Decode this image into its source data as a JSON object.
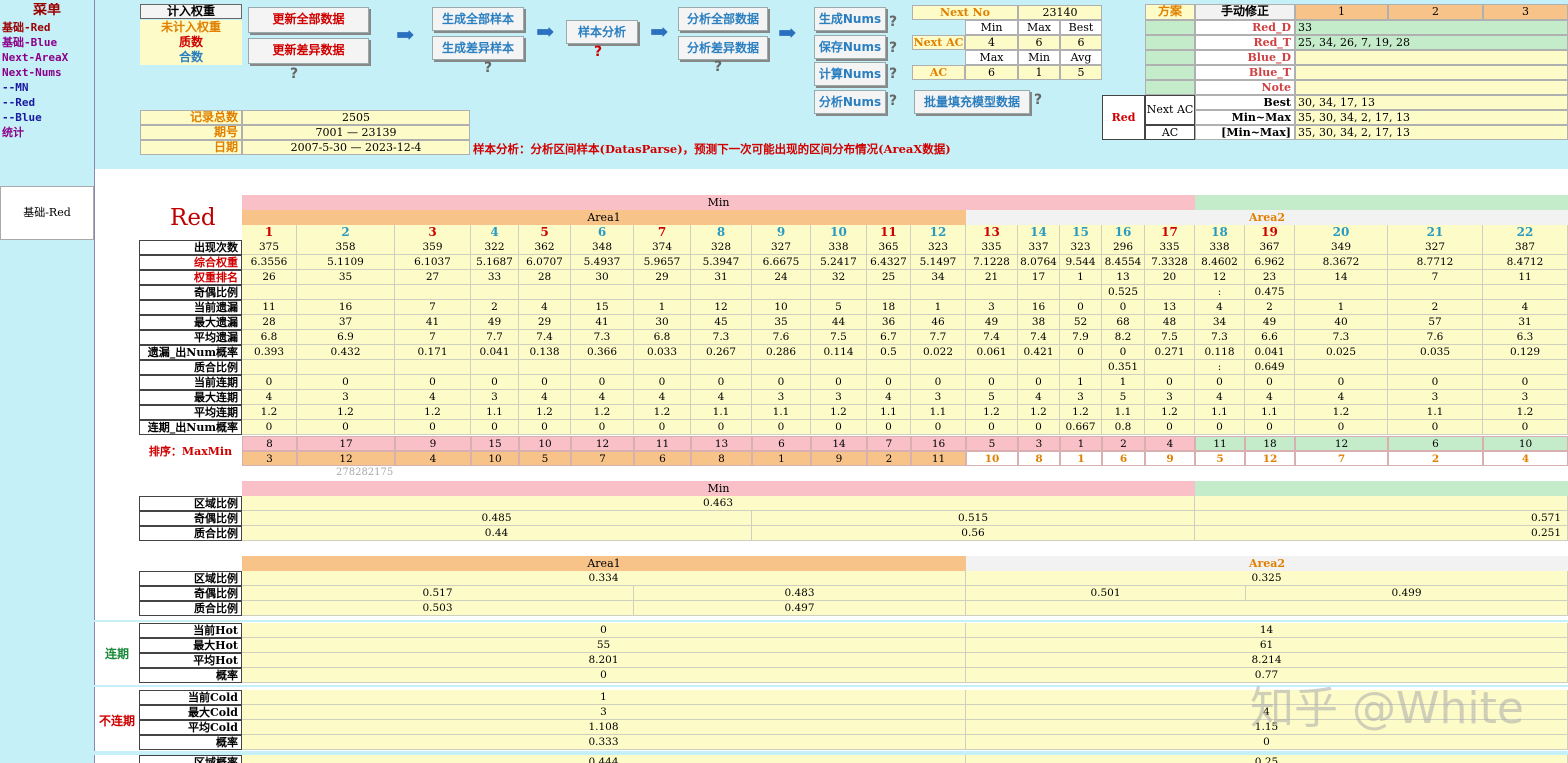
{
  "menu": {
    "title": "菜单",
    "items": [
      {
        "label": "基础-Red",
        "color": "#9b0000"
      },
      {
        "label": "基础-Blue",
        "color": "#8a008a"
      },
      {
        "label": "Next-AreaX",
        "color": "#8a008a"
      },
      {
        "label": "Next-Nums",
        "color": "#8a008a"
      },
      {
        "label": "--MN",
        "color": "#1a1aa0"
      },
      {
        "label": "--Red",
        "color": "#1a1aa0"
      },
      {
        "label": "--Blue",
        "color": "#1a1aa0"
      },
      {
        "label": "统计",
        "color": "#8a008a"
      }
    ]
  },
  "weights": {
    "counted": "计入权重",
    "not_counted": "未计入权重",
    "prime": "质数",
    "composite": "合数"
  },
  "buttons": {
    "update_all": "更新全部数据",
    "update_diff": "更新差异数据",
    "gen_all_sample": "生成全部样本",
    "gen_diff_sample": "生成差异样本",
    "sample_analysis": "样本分析",
    "analyze_all": "分析全部数据",
    "analyze_diff": "分析差异数据",
    "gen_nums": "生成Nums",
    "save_nums": "保存Nums",
    "calc_nums": "计算Nums",
    "analyze_nums": "分析Nums",
    "batch_fill": "批量填充模型数据",
    "q": "?"
  },
  "records": {
    "total_label": "记录总数",
    "total_value": "2505",
    "period_label": "期号",
    "period_value": "7001 — 23139",
    "date_label": "日期",
    "date_value": "2007-5-30 — 2023-12-4"
  },
  "sample_desc": "样本分析：分析区间样本(DatasParse)，预测下一次可能出现的区间分布情况(AreaX数据)",
  "next_panel": {
    "next_no_label": "Next No",
    "next_no_value": "23140",
    "h_min": "Min",
    "h_max": "Max",
    "h_best": "Best",
    "next_ac_label": "Next AC",
    "next_ac_min": "4",
    "next_ac_max": "6",
    "next_ac_best": "6",
    "h_max2": "Max",
    "h_min2": "Min",
    "h_avg": "Avg",
    "ac_label": "AC",
    "ac_max": "6",
    "ac_min": "1",
    "ac_avg": "5"
  },
  "plan": {
    "label": "方案",
    "manual": "手动修正",
    "cols": [
      "1",
      "2",
      "3"
    ],
    "rows": [
      {
        "label": "Red_D",
        "v": "33"
      },
      {
        "label": "Red_T",
        "v": "25, 34, 26, 7, 19, 28"
      },
      {
        "label": "Blue_D",
        "v": ""
      },
      {
        "label": "Blue_T",
        "v": ""
      },
      {
        "label": "Note",
        "v": ""
      }
    ]
  },
  "red_block": {
    "label": "Red",
    "next_ac": "Next AC",
    "ac": "AC",
    "best_label": "Best",
    "best_v": "30, 34, 17, 13",
    "minmax_label": "Min~Max",
    "minmax_v": "35, 30, 34, 2, 17, 13",
    "minmax2_label": "[Min~Max]",
    "minmax2_v": "35, 30, 34, 2, 17, 13"
  },
  "sheet_tab": "基础-Red",
  "red_title": "Red",
  "header": {
    "min": "Min",
    "area1": "Area1",
    "area2": "Area2"
  },
  "numbers": [
    "1",
    "2",
    "3",
    "4",
    "5",
    "6",
    "7",
    "8",
    "9",
    "10",
    "11",
    "12",
    "13",
    "14",
    "15",
    "16",
    "17",
    "18",
    "19",
    "20",
    "21",
    "22"
  ],
  "rows": [
    {
      "label": "出现次数",
      "color": "#000",
      "vals": [
        "375",
        "358",
        "359",
        "322",
        "362",
        "348",
        "374",
        "328",
        "327",
        "338",
        "365",
        "323",
        "335",
        "337",
        "323",
        "296",
        "335",
        "338",
        "367",
        "349",
        "327",
        "387"
      ]
    },
    {
      "label": "综合权重",
      "color": "#d00000",
      "vals": [
        "6.3556",
        "5.1109",
        "6.1037",
        "5.1687",
        "6.0707",
        "5.4937",
        "5.9657",
        "5.3947",
        "6.6675",
        "5.2417",
        "6.4327",
        "5.1497",
        "7.1228",
        "8.0764",
        "9.544",
        "8.4554",
        "7.3328",
        "8.4602",
        "6.962",
        "8.3672",
        "8.7712",
        "8.4712"
      ]
    },
    {
      "label": "权重排名",
      "color": "#d00000",
      "vals": [
        "26",
        "35",
        "27",
        "33",
        "28",
        "30",
        "29",
        "31",
        "24",
        "32",
        "25",
        "34",
        "21",
        "17",
        "1",
        "13",
        "20",
        "12",
        "23",
        "14",
        "7",
        "11"
      ]
    },
    {
      "label": "奇偶比例",
      "color": "#000",
      "vals": [
        "",
        "",
        "",
        "",
        "",
        "",
        "",
        "",
        "",
        "",
        "",
        "",
        "",
        "",
        "",
        "0.525",
        "",
        ":",
        "0.475",
        "",
        "",
        ""
      ]
    },
    {
      "label": "当前遗漏",
      "color": "#000",
      "vals": [
        "11",
        "16",
        "7",
        "2",
        "4",
        "15",
        "1",
        "12",
        "10",
        "5",
        "18",
        "1",
        "3",
        "16",
        "0",
        "0",
        "13",
        "4",
        "2",
        "1",
        "2",
        "4"
      ]
    },
    {
      "label": "最大遗漏",
      "color": "#000",
      "vals": [
        "28",
        "37",
        "41",
        "49",
        "29",
        "41",
        "30",
        "45",
        "35",
        "44",
        "36",
        "46",
        "49",
        "38",
        "52",
        "68",
        "48",
        "34",
        "49",
        "40",
        "57",
        "31"
      ]
    },
    {
      "label": "平均遗漏",
      "color": "#000",
      "vals": [
        "6.8",
        "6.9",
        "7",
        "7.7",
        "7.4",
        "7.3",
        "6.8",
        "7.3",
        "7.6",
        "7.5",
        "6.7",
        "7.7",
        "7.4",
        "7.4",
        "7.9",
        "8.2",
        "7.5",
        "7.3",
        "6.6",
        "7.3",
        "7.6",
        "6.3"
      ]
    },
    {
      "label": "遗漏_出Num概率",
      "color": "#000",
      "vals": [
        "0.393",
        "0.432",
        "0.171",
        "0.041",
        "0.138",
        "0.366",
        "0.033",
        "0.267",
        "0.286",
        "0.114",
        "0.5",
        "0.022",
        "0.061",
        "0.421",
        "0",
        "0",
        "0.271",
        "0.118",
        "0.041",
        "0.025",
        "0.035",
        "0.129"
      ]
    },
    {
      "label": "质合比例",
      "color": "#000",
      "vals": [
        "",
        "",
        "",
        "",
        "",
        "",
        "",
        "",
        "",
        "",
        "",
        "",
        "",
        "",
        "",
        "0.351",
        "",
        ":",
        "0.649",
        "",
        "",
        ""
      ]
    },
    {
      "label": "当前连期",
      "color": "#000",
      "vals": [
        "0",
        "0",
        "0",
        "0",
        "0",
        "0",
        "0",
        "0",
        "0",
        "0",
        "0",
        "0",
        "0",
        "0",
        "1",
        "1",
        "0",
        "0",
        "0",
        "0",
        "0",
        "0"
      ]
    },
    {
      "label": "最大连期",
      "color": "#000",
      "vals": [
        "4",
        "3",
        "4",
        "3",
        "4",
        "4",
        "4",
        "4",
        "3",
        "3",
        "4",
        "3",
        "5",
        "4",
        "3",
        "5",
        "3",
        "4",
        "4",
        "4",
        "3",
        "3"
      ]
    },
    {
      "label": "平均连期",
      "color": "#000",
      "vals": [
        "1.2",
        "1.2",
        "1.2",
        "1.1",
        "1.2",
        "1.2",
        "1.2",
        "1.1",
        "1.1",
        "1.2",
        "1.1",
        "1.1",
        "1.2",
        "1.2",
        "1.2",
        "1.1",
        "1.2",
        "1.1",
        "1.1",
        "1.2",
        "1.1",
        "1.2"
      ]
    },
    {
      "label": "连期_出Num概率",
      "color": "#000",
      "vals": [
        "0",
        "0",
        "0",
        "0",
        "0",
        "0",
        "0",
        "0",
        "0",
        "0",
        "0",
        "0",
        "0",
        "0",
        "0.667",
        "0.8",
        "0",
        "0",
        "0",
        "0",
        "0",
        "0"
      ]
    }
  ],
  "sort": {
    "label": "排序：MaxMin",
    "row1": [
      "8",
      "17",
      "9",
      "15",
      "10",
      "12",
      "11",
      "13",
      "6",
      "14",
      "7",
      "16",
      "5",
      "3",
      "1",
      "2",
      "4",
      "11",
      "18",
      "12",
      "6",
      "10"
    ],
    "row2": [
      "3",
      "12",
      "4",
      "10",
      "5",
      "7",
      "6",
      "8",
      "1",
      "9",
      "2",
      "11",
      "10",
      "8",
      "1",
      "6",
      "9",
      "5",
      "12",
      "7",
      "2",
      "4"
    ],
    "faded": "278282175"
  },
  "block2": {
    "hdr": "Min",
    "rows": [
      {
        "label": "区域比例",
        "a": "0.463",
        "b": ""
      },
      {
        "label": "奇偶比例",
        "a": "0.485",
        "b": "0.515",
        "c": "0.571"
      },
      {
        "label": "质合比例",
        "a": "0.44",
        "b": "0.56",
        "c": "0.251"
      }
    ]
  },
  "block3": {
    "hdr1": "Area1",
    "hdr2": "Area2",
    "r1": {
      "label": "区域比例",
      "a": "0.334",
      "b": "0.325"
    },
    "r2": {
      "label": "奇偶比例",
      "a": "0.517",
      "b": "0.483",
      "c": "0.501",
      "d": "0.499"
    },
    "r3": {
      "label": "质合比例",
      "a": "0.503",
      "b": "0.497"
    }
  },
  "lianqi": {
    "label": "连期",
    "rows": [
      {
        "label": "当前Hot",
        "a": "0",
        "b": "14"
      },
      {
        "label": "最大Hot",
        "a": "55",
        "b": "61"
      },
      {
        "label": "平均Hot",
        "a": "8.201",
        "b": "8.214"
      },
      {
        "label": "概率",
        "a": "0",
        "b": "0.77"
      }
    ]
  },
  "bulianqi": {
    "label": "不连期",
    "rows": [
      {
        "label": "当前Cold",
        "a": "1",
        "b": ""
      },
      {
        "label": "最大Cold",
        "a": "3",
        "b": "4"
      },
      {
        "label": "平均Cold",
        "a": "1.108",
        "b": "1.15"
      },
      {
        "label": "概率",
        "a": "0.333",
        "b": "0"
      }
    ]
  },
  "last_row": {
    "label": "区域概率",
    "a": "0.444",
    "b": "0.25"
  },
  "watermark": "知乎 @White"
}
